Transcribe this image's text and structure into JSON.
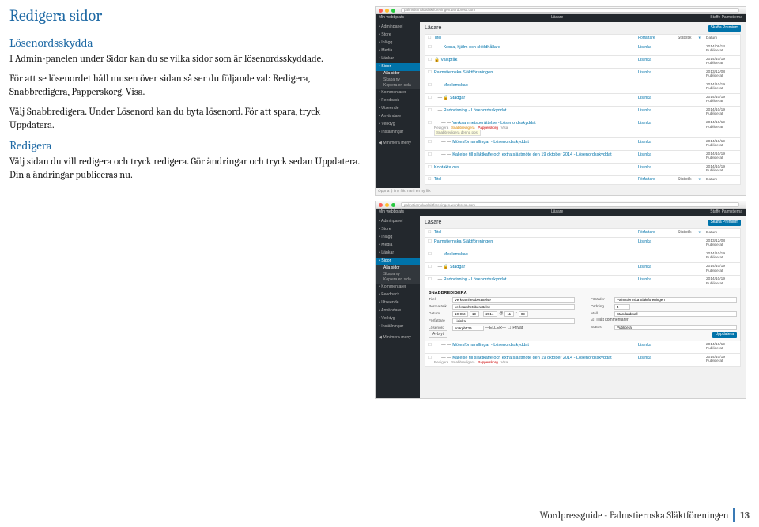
{
  "title": "Redigera sidor",
  "sections": {
    "losenord": {
      "heading": "Lösenordsskydda",
      "p1": "I Admin-panelen under Sidor kan du se vilka sidor som är lösenordsskyddade.",
      "p2": "För att se lösenordet håll musen över sidan så ser du följande val: Redigera, Snabbredigera, Papperskorg, Visa.",
      "p3": "Välj Snabbredigera. Under Lösenord kan du byta lösenord. För att spara, tryck Uppdatera."
    },
    "redigera": {
      "heading": "Redigera",
      "p1": "Välj sidan du vill redigera och tryck redigera. Gör ändringar och tryck sedan Uppdatera. Din a ändringar publiceras nu."
    }
  },
  "footer": {
    "text": "Wordpressguide - Palmstiernska Släktföreningen",
    "page": "13"
  },
  "wp": {
    "url": "palmstiernskaslaktforeningen.wordpress.com",
    "siteLabel": "Min webbplats",
    "adminbarRight": "Staffe Palmstierna",
    "pageTitle": "Läsare",
    "btnNew": "Skaffa Premium",
    "side": {
      "items": [
        "Adminpanel",
        "Store",
        "Inlägg",
        "Media",
        "Länkar",
        "Sidor",
        "Kommentarer",
        "Feedback",
        "Utseende",
        "Användare",
        "Verktyg",
        "Inställningar"
      ],
      "selected": "Sidor",
      "sub": [
        "Alla sidor",
        "Skapa ny",
        "Kopiera en sida"
      ],
      "minimize": "Minimera meny"
    },
    "listHead": {
      "title": "Titel",
      "author": "Författare",
      "stats": "Statistik",
      "date": "Datum"
    },
    "rows1": [
      {
        "indent": 1,
        "title": "Krona, hjälm och sköldhållare",
        "author": "Lisinka",
        "date": "2014/09/14",
        "status": "Publicerat"
      },
      {
        "indent": 0,
        "title": "Valspråk",
        "author": "Lisinka",
        "date": "2014/10/19",
        "status": "Publicerat",
        "lock": true
      },
      {
        "indent": 0,
        "title": "Palmstiernska Släktföreningen",
        "author": "Lisinka",
        "date": "2013/12/08",
        "status": "Publicerat"
      },
      {
        "indent": 1,
        "title": "Medlemskap",
        "author": "",
        "date": "2014/10/19",
        "status": "Publicerat"
      },
      {
        "indent": 1,
        "title": "Stadgar",
        "author": "Lisinka",
        "date": "2014/10/19",
        "status": "Publicerat",
        "lock": true
      },
      {
        "indent": 1,
        "title": "Redovisning - Lösenordsskyddat",
        "author": "Lisinka",
        "date": "2014/10/19",
        "status": "Publicerat"
      },
      {
        "indent": 2,
        "title": "Verksamhetsberättelse - Lösenordsskyddat",
        "author": "Lisinka",
        "date": "2014/10/19",
        "status": "Publicerat",
        "hover": true,
        "meta": "Redigera  Snabbredigera  Papperskorg  Visa",
        "meta2": "Snabbredigera denna post"
      },
      {
        "indent": 2,
        "title": "Mötesförhandlingar - Lösenordsskyddat",
        "author": "Lisinka",
        "date": "2014/10/19",
        "status": "Publicerat"
      },
      {
        "indent": 2,
        "title": "Kallelse till släktkaffe och extra släktmöte den 19 oktober 2014 - Lösenordsskyddat",
        "author": "Lisinka",
        "date": "2014/10/19",
        "status": "Publicerat"
      },
      {
        "indent": 0,
        "title": "Kontakta oss",
        "author": "Lisinka",
        "date": "2014/10/19",
        "status": "Publicerat"
      }
    ],
    "bottomTag": "Öppna § i ny flik: när i en ny flik",
    "rows2top": [
      {
        "indent": 0,
        "title": "Palmstiernska Släktföreningen",
        "author": "Lisinka",
        "date": "2013/12/08",
        "status": "Publicerat"
      },
      {
        "indent": 1,
        "title": "Medlemskap",
        "author": "",
        "date": "2014/10/19",
        "status": "Publicerat"
      },
      {
        "indent": 1,
        "title": "Stadgar",
        "author": "Lisinka",
        "date": "2014/10/19",
        "status": "Publicerat",
        "lock": true
      },
      {
        "indent": 1,
        "title": "Redovisning - Lösenordsskyddat",
        "author": "Lisinka",
        "date": "2014/10/19",
        "status": "Publicerat"
      }
    ],
    "qe": {
      "heading": "SNABBREDIGERA",
      "titleLbl": "Titel",
      "titleVal": "Verksamhetsberättelse",
      "slugLbl": "Permalänk",
      "slugVal": "verksamhetsberattelse",
      "dateLbl": "Datum",
      "dateVal": "10-Okt",
      "dateDay": "19",
      "dateYear": "2014",
      "dateH": "11",
      "dateM": "09",
      "authorLbl": "Författare",
      "authorVal": "Lisinka",
      "pwLbl": "Lösenord",
      "pwVal": "smKpb739",
      "pwOr": "—ELLER—",
      "pwPriv": "Privat",
      "parentLbl": "Förälder",
      "parentVal": "Palmstiernska Släktföreningen",
      "orderLbl": "Ordning",
      "orderVal": "4",
      "templateLbl": "Mall",
      "templateVal": "Standardmall",
      "commentsLbl": "Tillåt kommentarer",
      "statusLbl": "Status",
      "statusVal": "Publicerat",
      "cancel": "Avbryt",
      "update": "Uppdatera"
    },
    "rows2bottom": [
      {
        "indent": 2,
        "title": "Mötesförhandlingar - Lösenordsskyddat",
        "author": "Lisinka",
        "date": "2014/10/19",
        "status": "Publicerat"
      },
      {
        "indent": 2,
        "title": "Kallelse till släktkaffe och extra släktmöte den 19 oktober 2014 - Lösenordsskyddat",
        "author": "Lisinka",
        "date": "2014/10/19",
        "status": "Publicerat",
        "meta": "Redigera  Snabbredigera  Papperskorg  Visa"
      }
    ]
  }
}
